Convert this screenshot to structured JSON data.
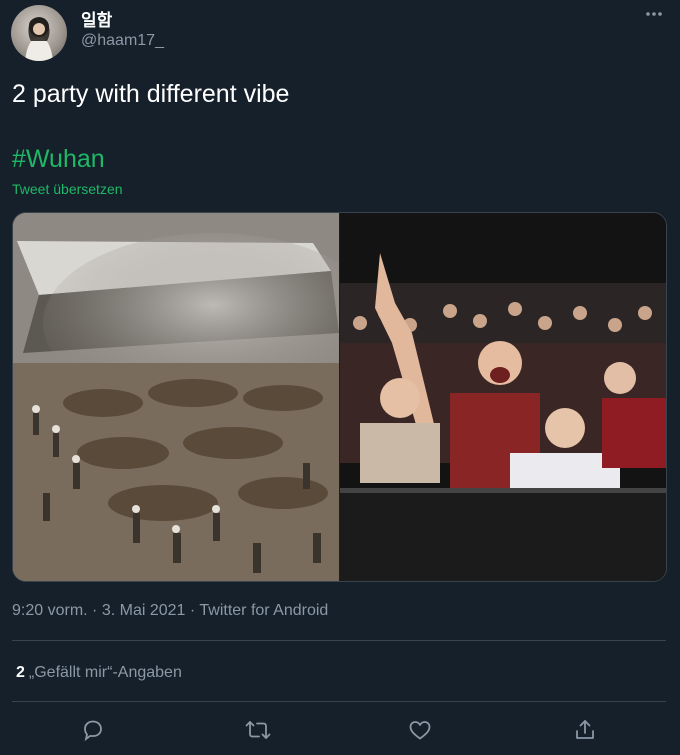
{
  "tweet": {
    "display_name": "일함",
    "handle": "@haam17_",
    "text": "2 party with different vibe",
    "hashtag": "#Wuhan",
    "translate_label": "Tweet übersetzen",
    "time": "9:20 vorm.",
    "date": "3. Mai 2021",
    "source": "Twitter for Android",
    "separator": "·",
    "likes_count": "2",
    "likes_label": "„Gefällt mir“-Angaben"
  },
  "icons": {
    "more": "more-icon",
    "reply": "reply-icon",
    "retweet": "retweet-icon",
    "like": "like-icon",
    "share": "share-icon"
  },
  "colors": {
    "background": "#15202b",
    "secondary_text": "#8b98a5",
    "accent": "#1fb866",
    "divider": "#38444d"
  }
}
